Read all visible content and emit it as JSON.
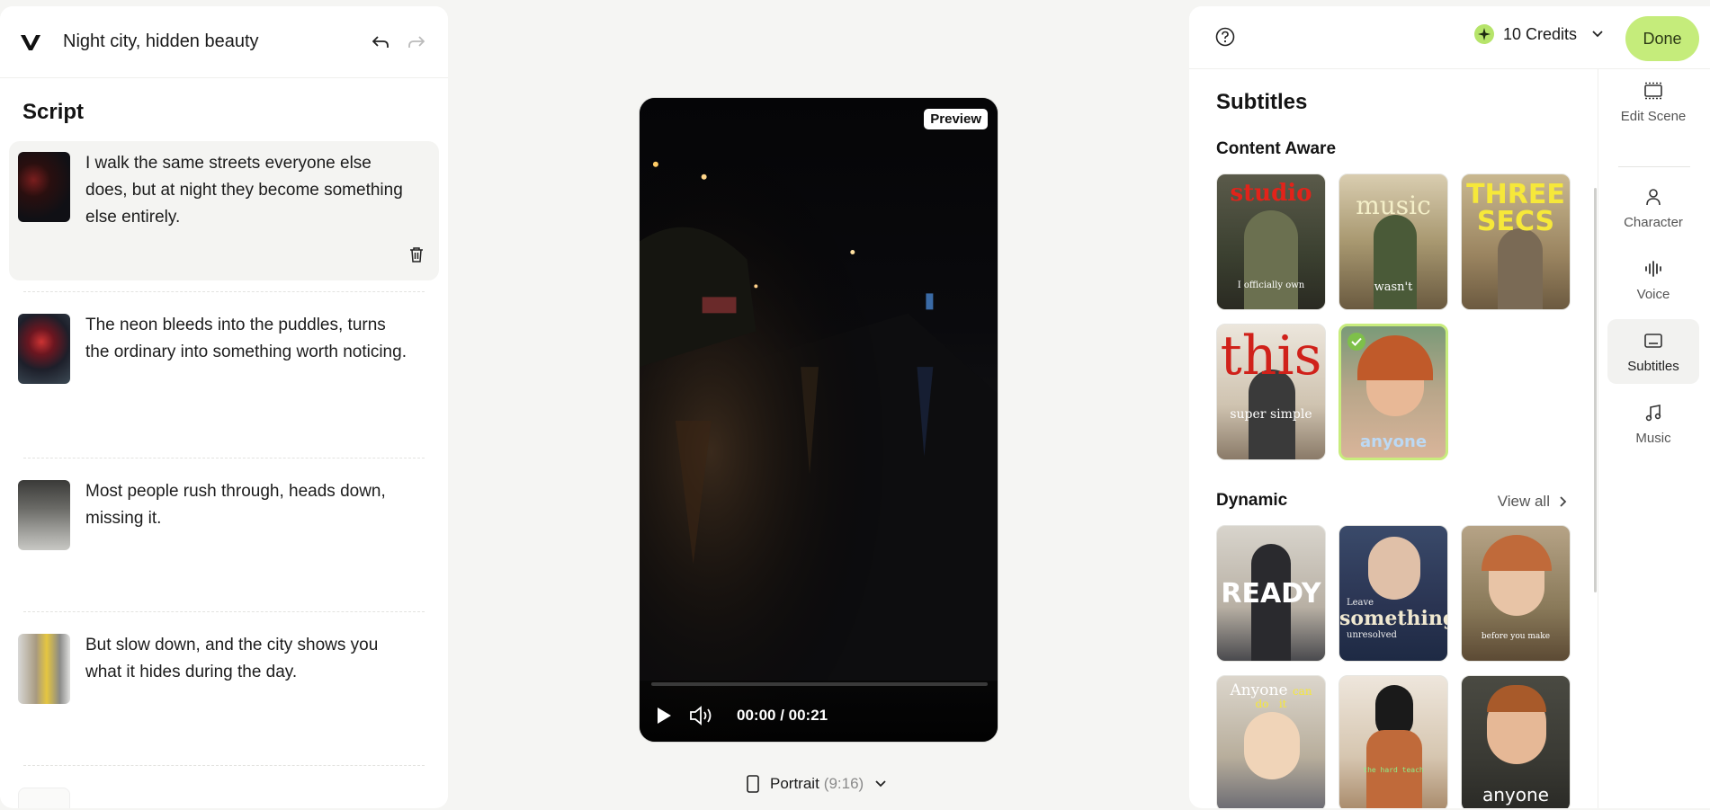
{
  "project": {
    "title": "Night city, hidden beauty"
  },
  "script": {
    "heading": "Script",
    "scenes": [
      {
        "text": "I walk the same streets everyone else does, but at night they become something else entirely."
      },
      {
        "text": "The neon bleeds into the puddles, turns the ordinary into something worth noticing."
      },
      {
        "text": "Most people rush through, heads down, missing it."
      },
      {
        "text": "But slow down, and the city shows you what it hides during the day."
      }
    ]
  },
  "preview": {
    "badge": "Preview",
    "timecode": "00:00 / 00:21",
    "progress": 0.0,
    "orientation_label": "Portrait",
    "orientation_ratio": "(9:16)"
  },
  "header": {
    "credits": "10 Credits",
    "done_label": "Done"
  },
  "subtitles": {
    "title": "Subtitles",
    "content_aware": {
      "heading": "Content Aware",
      "cards": [
        "studio",
        "music / wasn't",
        "THREE SECONDS",
        "this / super simple",
        "anyone"
      ],
      "selected_index": 4
    },
    "dynamic": {
      "heading": "Dynamic",
      "view_all": "View all",
      "cards": [
        "READY",
        "Leave something unresolved",
        "before you make",
        "Anyone can do it",
        "the hard teach",
        "anyone"
      ]
    }
  },
  "rail": [
    {
      "label": "Edit Scene",
      "icon": "scene-icon"
    },
    {
      "label": "Character",
      "icon": "person-icon"
    },
    {
      "label": "Voice",
      "icon": "waveform-icon"
    },
    {
      "label": "Subtitles",
      "icon": "subtitles-icon",
      "active": true
    },
    {
      "label": "Music",
      "icon": "music-note-icon"
    }
  ],
  "colors": {
    "accent": "#c5ec7b",
    "check": "#7ec04a",
    "credit_star": "#b6e46a"
  }
}
